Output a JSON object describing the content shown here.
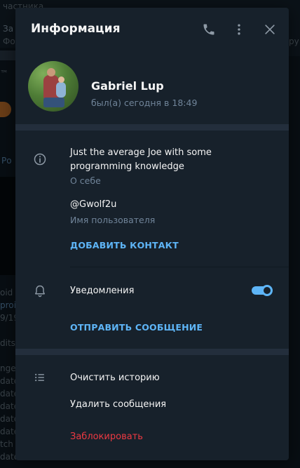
{
  "background": {
    "snippet_top": "частника",
    "snippet_za": "За",
    "snippet_fo": "Фо",
    "snippet_tm": "™",
    "snippet_ro": "Ро",
    "snippet_oid": "oid",
    "snippet_proi": "proi",
    "snippet_date": "9/19",
    "snippet_dits": "dits",
    "snippet_ngel": "ngel",
    "snippet_date1": "date",
    "snippet_date2": "date",
    "snippet_date3": "date",
    "snippet_date4": "date",
    "snippet_date5": "date",
    "snippet_tch": "tch",
    "snippet_date6": "date",
    "snippet_ru": "ру"
  },
  "modal": {
    "title": "Информация",
    "icons": {
      "call": "phone-icon",
      "menu": "more-vertical-icon",
      "close": "close-icon"
    }
  },
  "profile": {
    "name": "Gabriel Lup",
    "status": "был(а) сегодня в 18:49"
  },
  "info": {
    "bio": "Just the average Joe with some programming knowledge",
    "bio_label": "О себе",
    "username": "@Gwolf2u",
    "username_label": "Имя пользователя",
    "add_contact": "ДОБАВИТЬ КОНТАКТ"
  },
  "notifications": {
    "label": "Уведомления",
    "enabled": true,
    "send_message": "ОТПРАВИТЬ СООБЩЕНИЕ"
  },
  "actions": {
    "clear_history": "Очистить историю",
    "delete_messages": "Удалить сообщения",
    "block": "Заблокировать"
  },
  "colors": {
    "accent": "#5eb5f7",
    "danger": "#ec3942",
    "panel": "#17212b",
    "secondary_text": "#708499"
  }
}
